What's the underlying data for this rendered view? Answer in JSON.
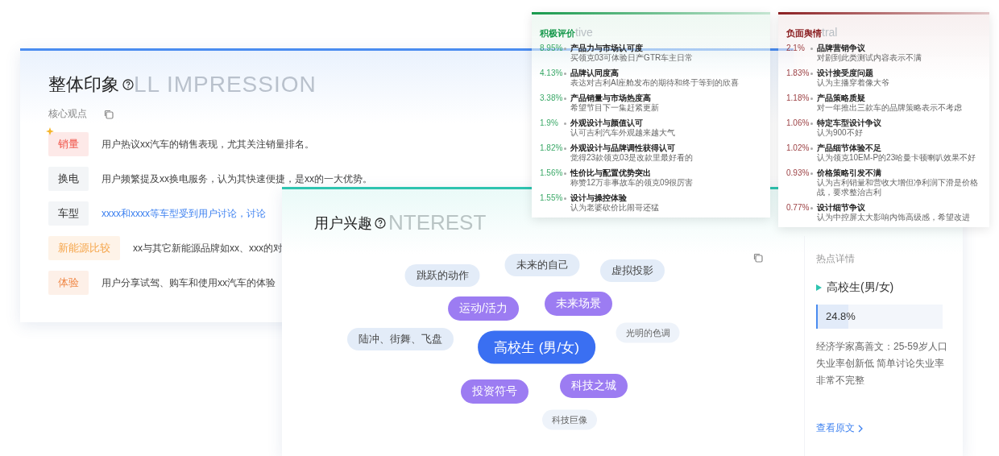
{
  "impression": {
    "title": "整体印象",
    "ghost_text": "LL IMPRESSION",
    "section_label": "核心观点",
    "rows": [
      {
        "tag": "销量",
        "color": "#f0554a",
        "text": "用户热议xx汽车的销售表现，尤其关注销量排名。",
        "highlighted": false
      },
      {
        "tag": "换电",
        "color": "#333333",
        "text": "用户频繁提及xx换电服务，认为其快速便捷，是xx的一大优势。",
        "highlighted": false
      },
      {
        "tag": "车型",
        "color": "#333333",
        "text": "xxxx和xxxx等车型受到用户讨论，讨论",
        "highlighted": true
      },
      {
        "tag": "新能源比较",
        "color": "#f5a54a",
        "text": "xx与其它新能源品牌如xx、xxx的对",
        "highlighted": false
      },
      {
        "tag": "体验",
        "color": "#f08a4a",
        "text": "用户分享试驾、购车和使用xx汽车的体验",
        "highlighted": false
      }
    ]
  },
  "interest": {
    "title": "用户兴趣",
    "ghost_text": "NTEREST",
    "bubbles": [
      {
        "label": "跳跃的动作",
        "kind": "secondary"
      },
      {
        "label": "未来的自己",
        "kind": "secondary"
      },
      {
        "label": "虚拟投影",
        "kind": "secondary"
      },
      {
        "label": "运动/活力",
        "kind": "primary"
      },
      {
        "label": "未来场景",
        "kind": "primary"
      },
      {
        "label": "陆冲、街舞、飞盘",
        "kind": "secondary"
      },
      {
        "label": "高校生 (男/女)",
        "kind": "center"
      },
      {
        "label": "光明的色调",
        "kind": "minor"
      },
      {
        "label": "投资符号",
        "kind": "primary"
      },
      {
        "label": "科技之城",
        "kind": "primary"
      },
      {
        "label": "科技巨像",
        "kind": "minor"
      }
    ],
    "detail": {
      "heading": "热点详情",
      "topic": "高校生(男/女)",
      "share": "24.8%",
      "level": 0.248,
      "text": "经济学家高善文：25-59岁人口失业率创新低 简单讨论失业率非常不完整",
      "link": "查看原文"
    }
  },
  "sentiments": [
    {
      "title": "积极评价",
      "ghost_text": "tive",
      "color": "#17994c",
      "items": [
        {
          "share": "8.95%",
          "title": "产品力与市场认可度",
          "desc": "买领克03可体验日产GTR车主日常"
        },
        {
          "share": "4.13%",
          "title": "品牌认同度高",
          "desc": "表达对吉利AI座舱发布的期待和终于等到的欣喜"
        },
        {
          "share": "3.38%",
          "title": "产品销量与市场热度高",
          "desc": "希望节目下一集赶紧更新"
        },
        {
          "share": "1.9%",
          "title": "外观设计与颜值认可",
          "desc": "认可吉利汽车外观越来越大气"
        },
        {
          "share": "1.82%",
          "title": "外观设计与品牌调性获得认可",
          "desc": "觉得23款领克03是改款里最好看的"
        },
        {
          "share": "1.56%",
          "title": "性价比与配置优势突出",
          "desc": "称赞12万非事故车的领克09很厉害"
        },
        {
          "share": "1.55%",
          "title": "设计与操控体验",
          "desc": "认为老婆砍价比闹哥还猛"
        }
      ]
    },
    {
      "title": "负面舆情",
      "ghost_text": "tral",
      "color": "#8b1f22",
      "items": [
        {
          "share": "2.1%",
          "title": "品牌营销争议",
          "desc": "对剧到此类测试内容表示不满"
        },
        {
          "share": "1.83%",
          "title": "设计接受度问题",
          "desc": "认为主播穿着像大爷"
        },
        {
          "share": "1.18%",
          "title": "产品策略质疑",
          "desc": "对一年推出三款车的品牌策略表示不考虑"
        },
        {
          "share": "1.06%",
          "title": "特定车型设计争议",
          "desc": "认为900不好"
        },
        {
          "share": "1.02%",
          "title": "产品细节体验不足",
          "desc": "认为领克10EM-P的23哈曼卡顿喇叭效果不好"
        },
        {
          "share": "0.93%",
          "title": "价格策略引发不满",
          "desc": "认为吉利销量和营收大增但净利润下滑是价格战，要求整治吉利"
        },
        {
          "share": "0.77%",
          "title": "设计细节争议",
          "desc": "认为中控屏太大影响内饰高级感，希望改进"
        }
      ]
    }
  ]
}
